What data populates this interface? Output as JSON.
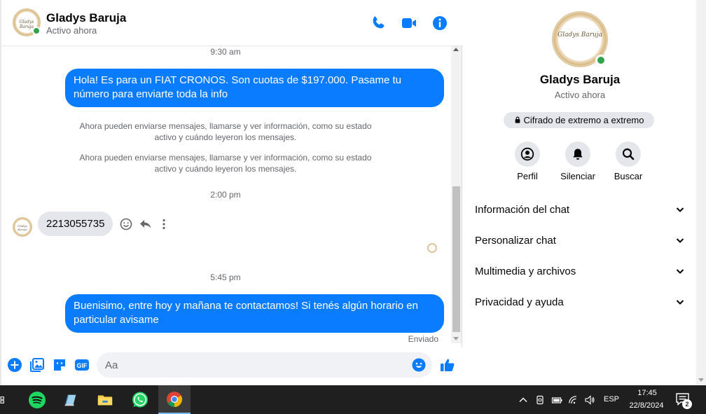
{
  "chat_header": {
    "contact_name": "Gladys Baruja",
    "status": "Activo ahora",
    "avatar_text": "Gladys Baruja"
  },
  "messages": {
    "time_1": "9:30 am",
    "msg_out_1": "Hola! Es para un FIAT CRONOS. Son cuotas de $197.000. Pasame tu número para enviarte toda la info",
    "system_1": "Ahora pueden enviarse mensajes, llamarse y ver información, como su estado activo y cuándo leyeron los mensajes.",
    "system_2": "Ahora pueden enviarse mensajes, llamarse y ver información, como su estado activo y cuándo leyeron los mensajes.",
    "time_2": "2:00 pm",
    "msg_in_1": "2213055735",
    "time_3": "5:45 pm",
    "msg_out_2": "Buenisimo, entre hoy y mañana te contactamos! Si tenés algún horario en particular avisame",
    "sent_status": "Enviado"
  },
  "composer": {
    "placeholder": "Aa"
  },
  "info_panel": {
    "name": "Gladys Baruja",
    "status": "Activo ahora",
    "encryption_badge": "Cifrado de extremo a extremo",
    "actions": [
      {
        "label": "Perfil",
        "icon": "profile-icon"
      },
      {
        "label": "Silenciar",
        "icon": "bell-icon"
      },
      {
        "label": "Buscar",
        "icon": "search-icon"
      }
    ],
    "sections": [
      "Información del chat",
      "Personalizar chat",
      "Multimedia y archivos",
      "Privacidad y ayuda"
    ]
  },
  "taskbar": {
    "language": "ESP",
    "time": "17:45",
    "date": "22/8/2024",
    "notification_count": "2"
  },
  "colors": {
    "accent": "#0a7cff",
    "online": "#31a24c",
    "bubble_in": "#e4e6eb",
    "taskbar": "#1f1f1f"
  }
}
